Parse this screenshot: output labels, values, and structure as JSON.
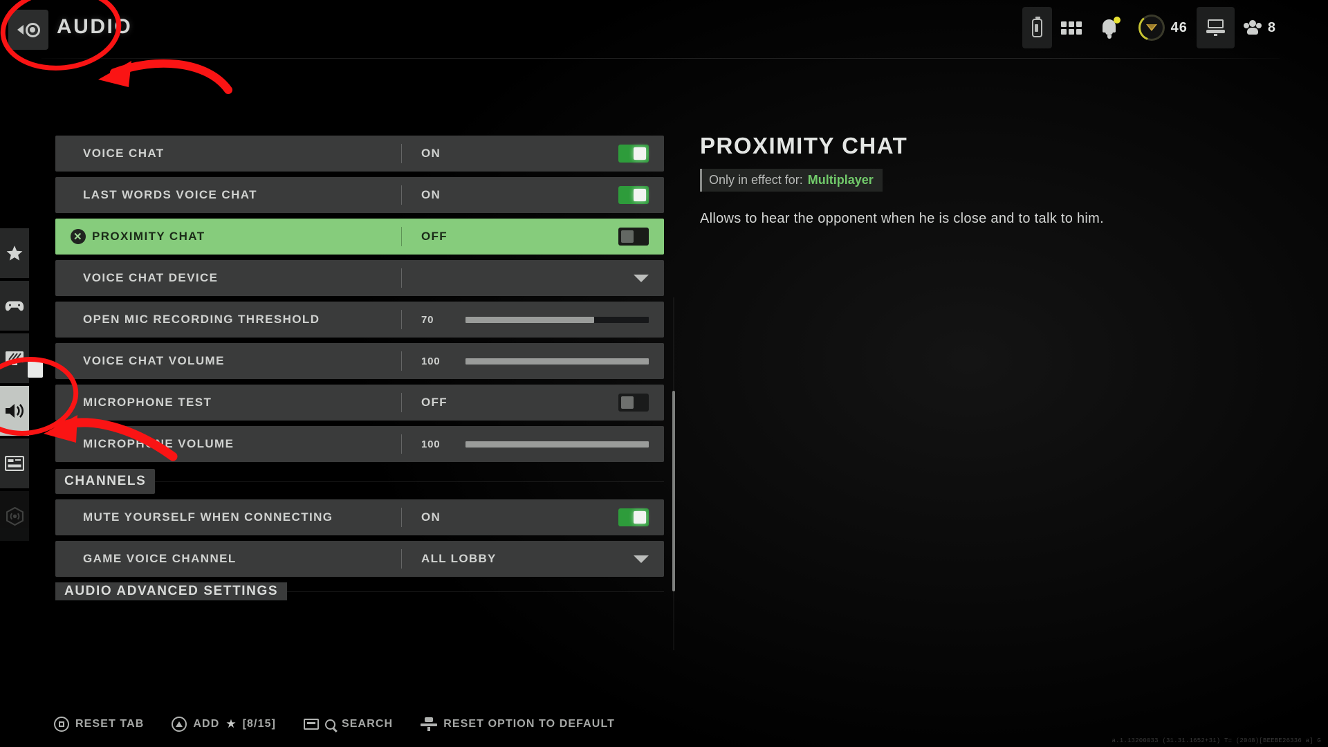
{
  "header": {
    "title": "AUDIO",
    "back_icon": "back-eye-icon"
  },
  "hud": {
    "battery_icon": "battery-icon",
    "apps_icon": "grid-apps-icon",
    "notifications_icon": "bell-icon",
    "rank_icon": "rank-badge-icon",
    "rank_value": "46",
    "console_icon": "console-device-icon",
    "party_icon": "party-players-icon",
    "party_count": "8"
  },
  "sidebar": {
    "items": [
      {
        "name": "favorites",
        "icon": "star-icon",
        "selected": false,
        "dim": false
      },
      {
        "name": "controller",
        "icon": "gamepad-icon",
        "selected": false,
        "dim": false
      },
      {
        "name": "graphics",
        "icon": "monitor-icon",
        "selected": false,
        "dim": false
      },
      {
        "name": "audio",
        "icon": "speaker-icon",
        "selected": true,
        "dim": false
      },
      {
        "name": "interface",
        "icon": "hud-layout-icon",
        "selected": false,
        "dim": false
      },
      {
        "name": "account",
        "icon": "antenna-icon",
        "selected": false,
        "dim": true
      }
    ]
  },
  "settings": {
    "rows": [
      {
        "label": "VOICE CHAT",
        "type": "toggle",
        "value": "ON",
        "on": true,
        "highlight": false
      },
      {
        "label": "LAST WORDS VOICE CHAT",
        "type": "toggle",
        "value": "ON",
        "on": true,
        "highlight": false
      },
      {
        "label": "PROXIMITY CHAT",
        "type": "toggle",
        "value": "OFF",
        "on": false,
        "highlight": true,
        "button_glyph": "✕"
      },
      {
        "label": "VOICE CHAT DEVICE",
        "type": "dropdown",
        "value": "",
        "highlight": false
      },
      {
        "label": "OPEN MIC RECORDING THRESHOLD",
        "type": "slider",
        "value": "70",
        "percent": 70,
        "highlight": false
      },
      {
        "label": "VOICE CHAT VOLUME",
        "type": "slider",
        "value": "100",
        "percent": 100,
        "highlight": false
      },
      {
        "label": "MICROPHONE TEST",
        "type": "toggle",
        "value": "OFF",
        "on": false,
        "highlight": false
      },
      {
        "label": "MICROPHONE VOLUME",
        "type": "slider",
        "value": "100",
        "percent": 100,
        "highlight": false
      },
      {
        "label": "CHANNELS",
        "type": "section",
        "highlight": false
      },
      {
        "label": "MUTE YOURSELF WHEN CONNECTING",
        "type": "toggle",
        "value": "ON",
        "on": true,
        "highlight": false
      },
      {
        "label": "GAME VOICE CHANNEL",
        "type": "dropdown",
        "value": "ALL LOBBY",
        "highlight": false
      },
      {
        "label": "AUDIO ADVANCED SETTINGS",
        "type": "section",
        "clipped": true,
        "highlight": false
      }
    ]
  },
  "detail": {
    "title": "PROXIMITY CHAT",
    "effect_label": "Only in effect for:",
    "effect_mode": "Multiplayer",
    "description": "Allows to hear the opponent when he is close and to talk to him."
  },
  "footer": {
    "items": [
      {
        "label": "RESET TAB",
        "icon": "square-button-icon"
      },
      {
        "label": "ADD",
        "icon": "triangle-button-icon",
        "star": "★",
        "count": "[8/15]"
      },
      {
        "label": "SEARCH",
        "icon": "keyboard-search-icon"
      },
      {
        "label": "RESET OPTION TO DEFAULT",
        "icon": "reset-default-icon"
      }
    ]
  },
  "build_text": "a.1.13200033 (31.31.1652+31) T= (2048)[BEEBE26336 a] G",
  "colors": {
    "accent_green": "#86cc7c",
    "toggle_on": "#2e9c3b",
    "mode_green": "#71c96a",
    "row_bg": "#3a3b3b",
    "annotation_red": "#fa1414"
  },
  "annotations": {
    "ellipse_header": "highlights the AUDIO page title and back button",
    "ellipse_sidebar": "highlights the audio speaker sidebar tab",
    "arrow_header": "arrow pointing to the AUDIO title",
    "arrow_sidebar": "arrow pointing to the audio sidebar tab"
  }
}
